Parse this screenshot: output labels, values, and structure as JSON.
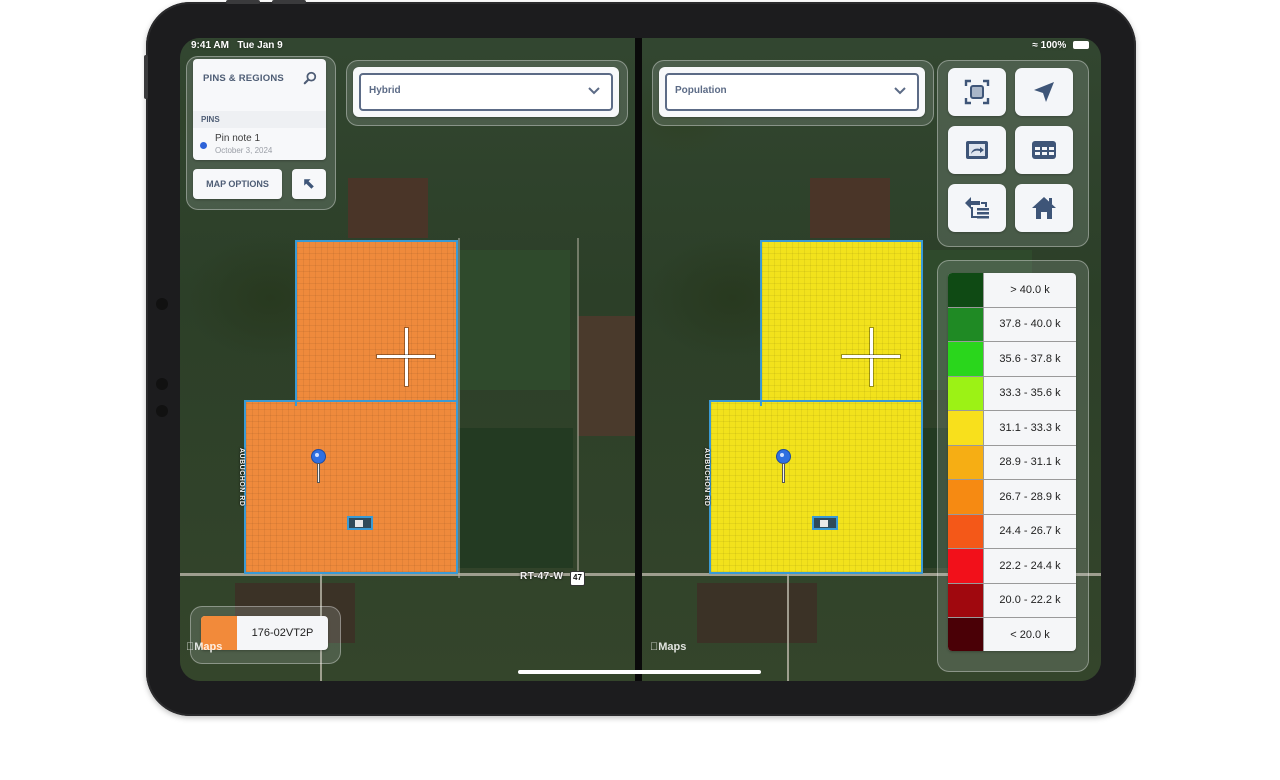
{
  "status_bar": {
    "time": "9:41 AM",
    "date": "Tue Jan 9",
    "wifi_icon": "wifi-icon",
    "battery": "100%",
    "battery_icon": "battery-icon"
  },
  "left_pane": {
    "pins_panel": {
      "title": "PINS & REGIONS",
      "search_icon": "search-icon",
      "section_label": "PINS",
      "items": [
        {
          "title": "Pin note 1",
          "date": "October 3, 2024",
          "dot_color": "#2e63d8"
        }
      ]
    },
    "map_options_label": "MAP OPTIONS",
    "collapse_icon": "arrow-up-left-icon",
    "layer_dropdown": {
      "value": "Hybrid",
      "icon": "chevron-down-icon"
    },
    "hybrid_legend": {
      "label": "176-02VT2P",
      "color": "#f28a3a"
    },
    "field_color": "#ef8a3c",
    "road_label": "RT-47-W",
    "route_shield": "47",
    "side_road_label": "AUBUCHON RD",
    "map_attribution": "Maps"
  },
  "right_pane": {
    "layer_dropdown": {
      "value": "Population",
      "icon": "chevron-down-icon"
    },
    "field_color": "#f2e21c",
    "toolbar": [
      {
        "name": "fit-bounds-button",
        "icon": "fit-bounds-icon"
      },
      {
        "name": "locate-button",
        "icon": "location-arrow-icon"
      },
      {
        "name": "screen-share-button",
        "icon": "screen-share-icon"
      },
      {
        "name": "table-view-button",
        "icon": "table-icon"
      },
      {
        "name": "swap-layers-button",
        "icon": "swap-list-icon"
      },
      {
        "name": "home-button",
        "icon": "home-icon"
      }
    ],
    "legend": [
      {
        "label": "> 40.0 k",
        "color": "#0f4a14"
      },
      {
        "label": "37.8 - 40.0 k",
        "color": "#1f8a24"
      },
      {
        "label": "35.6 - 37.8 k",
        "color": "#2ad61c"
      },
      {
        "label": "33.3 - 35.6 k",
        "color": "#9cf215"
      },
      {
        "label": "31.1 - 33.3 k",
        "color": "#f8e01c"
      },
      {
        "label": "28.9 - 31.1 k",
        "color": "#f6ae14"
      },
      {
        "label": "26.7 - 28.9 k",
        "color": "#f68a12"
      },
      {
        "label": "24.4 - 26.7 k",
        "color": "#f45818"
      },
      {
        "label": "22.2 - 24.4 k",
        "color": "#f2101a"
      },
      {
        "label": "20.0 - 22.2 k",
        "color": "#a0080e"
      },
      {
        "label": "< 20.0 k",
        "color": "#4a0006"
      }
    ],
    "map_attribution": "Maps"
  }
}
